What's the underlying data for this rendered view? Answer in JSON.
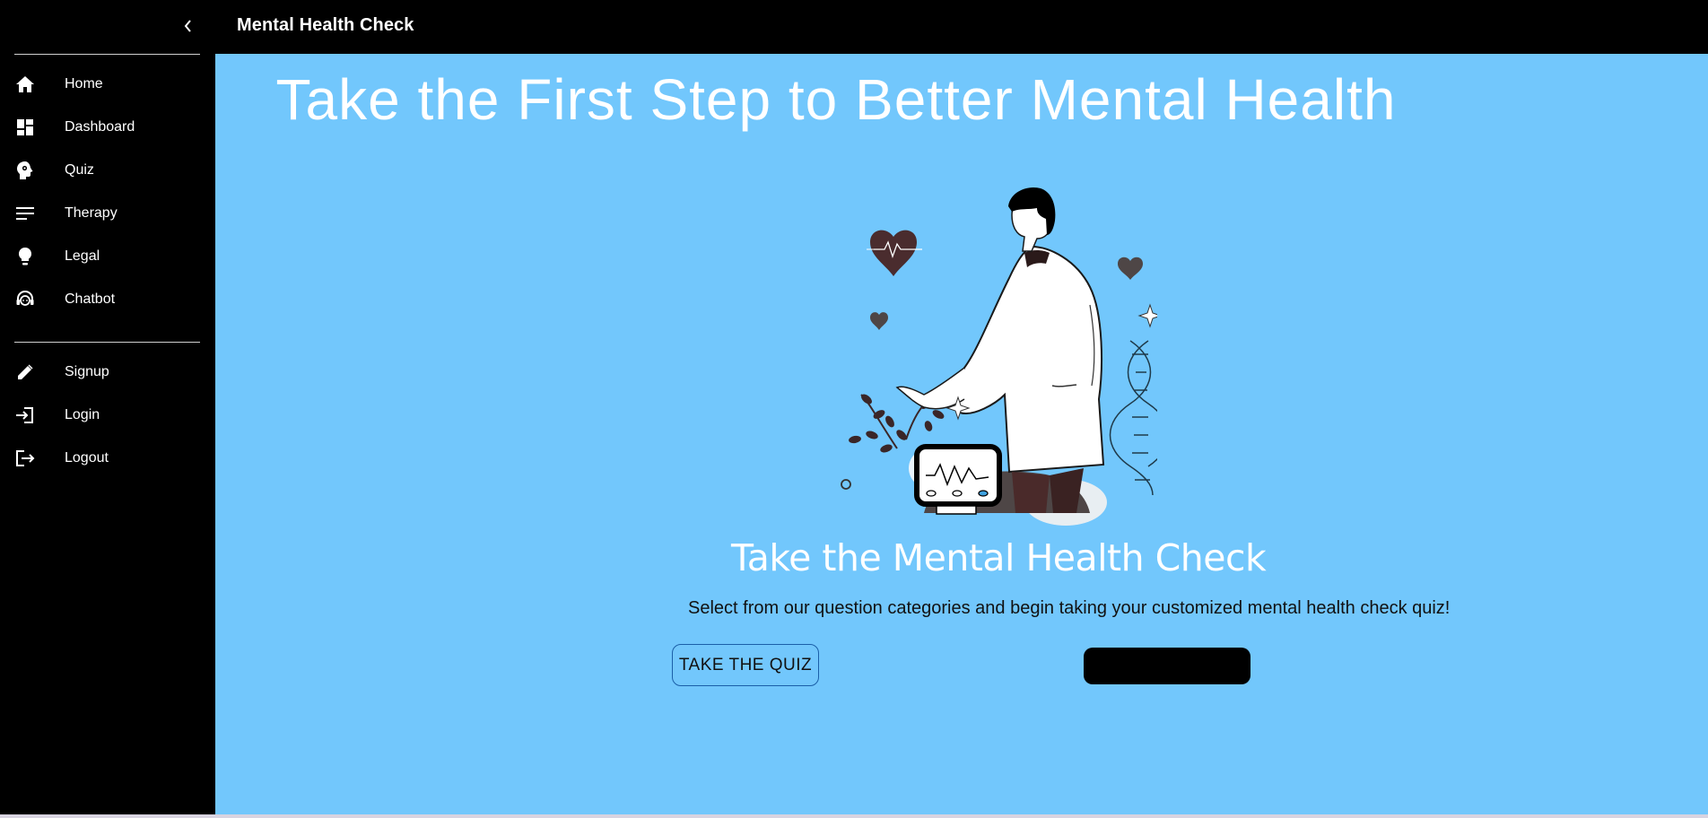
{
  "app": {
    "title": "Mental Health Check"
  },
  "drawer": {
    "collapse_icon": "chevron-left-icon",
    "items": [
      {
        "label": "Home",
        "icon": "home-icon"
      },
      {
        "label": "Dashboard",
        "icon": "dashboard-icon"
      },
      {
        "label": "Quiz",
        "icon": "psychology-icon"
      },
      {
        "label": "Therapy",
        "icon": "notes-icon"
      },
      {
        "label": "Legal",
        "icon": "lightbulb-icon"
      },
      {
        "label": "Chatbot",
        "icon": "support-agent-icon"
      }
    ],
    "account_items": [
      {
        "label": "Signup",
        "icon": "pencil-icon"
      },
      {
        "label": "Login",
        "icon": "login-icon"
      },
      {
        "label": "Logout",
        "icon": "logout-icon"
      }
    ]
  },
  "main": {
    "hero_title": "Take the First Step to Better Mental Health",
    "section_title": "Take the Mental Health Check",
    "section_description": "Select from our question categories and begin taking your customized mental health check quiz!",
    "quiz_button_label": "TAKE THE QUIZ",
    "secondary_button_label": ""
  },
  "colors": {
    "background": "#72c7fc",
    "drawer": "#000000",
    "app_bar": "#000000",
    "heart": "#4a2c2e",
    "text_light": "#ffffff"
  }
}
